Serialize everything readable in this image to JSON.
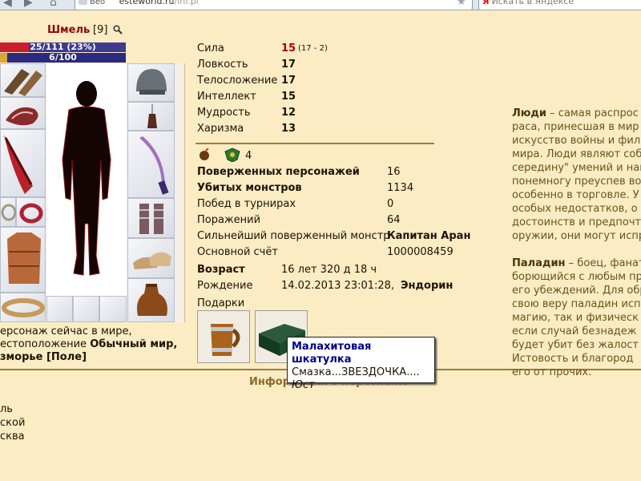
{
  "browser": {
    "back_tab": "Beo",
    "url_domain": "esteworld.ru",
    "url_path": "/inf.pl",
    "search_placeholder": "Искать в Яндексе",
    "search_logo": "Я"
  },
  "character": {
    "name": "Шмель",
    "level": "[9]",
    "hp_text": "25/111 (23%)",
    "hp_fraction": 0.23,
    "mp_text": "6/100",
    "mp_fraction": 0.06
  },
  "stats": [
    {
      "label": "Сила",
      "value": "15",
      "extra": "(17 - 2)"
    },
    {
      "label": "Ловкость",
      "value": "17"
    },
    {
      "label": "Телосложение",
      "value": "17"
    },
    {
      "label": "Интеллект",
      "value": "15"
    },
    {
      "label": "Мудрость",
      "value": "12"
    },
    {
      "label": "Харизма",
      "value": "13"
    }
  ],
  "badge_count": "4",
  "records": [
    {
      "label": "Поверженных персонажей",
      "value": "16",
      "bold": true
    },
    {
      "label": "Убитых монстров",
      "value": "1134",
      "bold": true
    },
    {
      "label": "Побед в турнирах",
      "value": "0"
    },
    {
      "label": "Поражений",
      "value": "64"
    },
    {
      "label": "Сильнейший поверженный монстр",
      "value": "Капитан Аран"
    },
    {
      "label": "Основной счёт",
      "value": "1000008459"
    }
  ],
  "age": {
    "label": "Возраст",
    "value": "16 лет 320 д 18 ч"
  },
  "birth": {
    "label": "Рождение",
    "value": "14.02.2013 23:01:28,",
    "place": "Эндорин"
  },
  "gifts_label": "Подарки",
  "tooltip": {
    "title": "Малахитовая шкатулка",
    "text": "Смазка...ЗВЕЗДОЧКА....",
    "author": "Юст"
  },
  "location": {
    "line1": "ерсонаж сейчас в мире,",
    "line2_prefix": "естоположение",
    "line2_value": "Обычный мир,",
    "line3": "зморье [Поле]"
  },
  "section_title": "Информация о персонаже",
  "info_lines": [
    "ль",
    "ской",
    "сква"
  ],
  "description": {
    "race_name": "Люди",
    "race_lines": [
      " – самая распрос",
      "раса, принесшая в мир",
      "искусство войны и фил",
      "мира. Люди являют соб",
      "середину\" умений и нав",
      "понемногу преуспев во",
      "особенно в торговле. У",
      "особых недостатков, о",
      "достоинств и предпочте",
      "оружии, они могут испр"
    ],
    "class_name": "Паладин",
    "class_lines": [
      " – боец, фанат",
      "борющийся с любым пр",
      "его убеждений. Для обр",
      "свою веру паладин исп",
      "магию, так и физическ",
      "если случай безнадеж",
      "будет убит без жалост",
      "Истовость и благород",
      "его от прочих."
    ]
  },
  "colors": {
    "page_bg": "#fbecc4",
    "name_red": "#8b0a0a",
    "hp_red": "#c8202c",
    "tooltip_title_blue": "#00008b",
    "description_brown": "#6b5418"
  }
}
